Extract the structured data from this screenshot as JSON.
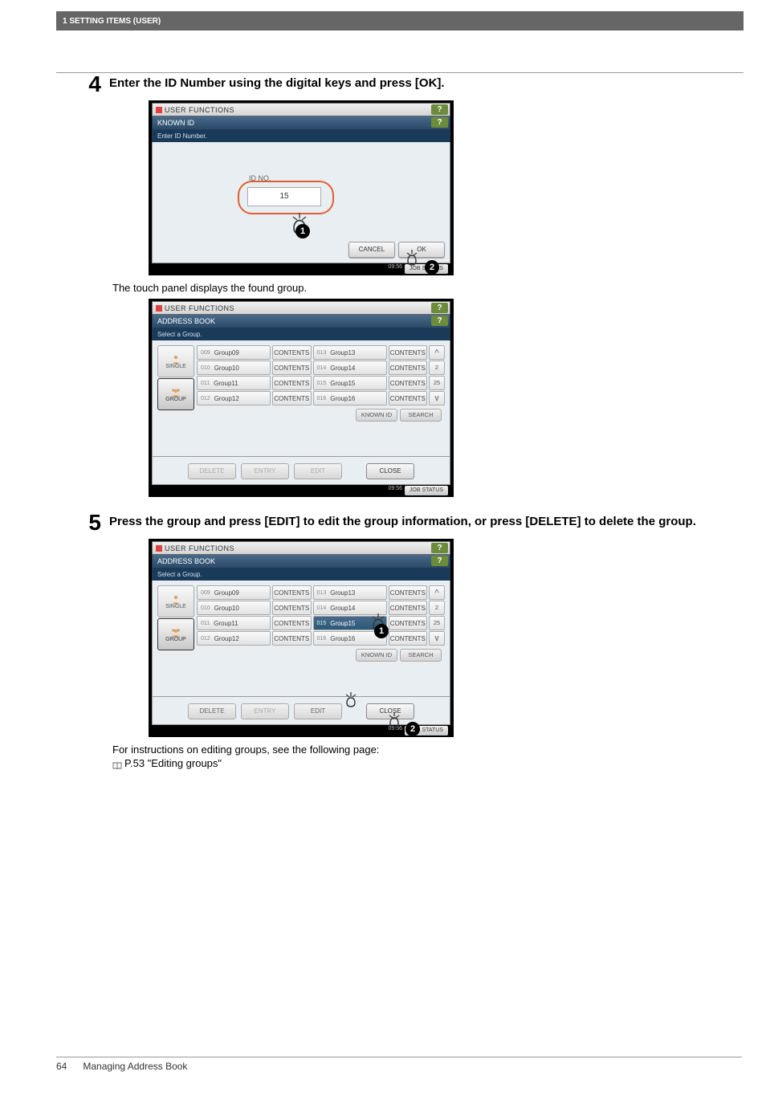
{
  "header": {
    "title": "1 SETTING ITEMS (USER)"
  },
  "step4": {
    "num": "4",
    "text": "Enter the ID Number using the digital keys and press [OK].",
    "after": "The touch panel displays the found group."
  },
  "step5": {
    "num": "5",
    "text": "Press the group and press [EDIT] to edit the group information, or press [DELETE] to delete the group.",
    "after1": "For instructions on editing groups, see the following page:",
    "after2": "P.53 \"Editing groups\""
  },
  "panel1": {
    "title": "USER FUNCTIONS",
    "subtitle": "KNOWN ID",
    "note": "Enter ID Number.",
    "idno_label": "ID NO.",
    "id_value": "15",
    "cancel": "CANCEL",
    "ok": "OK",
    "time": "09:56",
    "status": "JOB STATUS",
    "help": "?",
    "badge1": "1",
    "badge2": "2"
  },
  "panelA": {
    "title": "USER FUNCTIONS",
    "subtitle": "ADDRESS BOOK",
    "note": "Select a Group.",
    "tab_single": "SINGLE",
    "tab_group": "GROUP",
    "contents": "CONTENTS",
    "known_id": "KNOWN ID",
    "search": "SEARCH",
    "delete": "DELETE",
    "entry": "ENTRY",
    "edit": "EDIT",
    "close": "CLOSE",
    "page_cur": "2",
    "page_total": "25",
    "time": "09:56",
    "status": "JOB STATUS",
    "help": "?",
    "rows_left": [
      {
        "num": "009",
        "name": "Group09"
      },
      {
        "num": "010",
        "name": "Group10"
      },
      {
        "num": "011",
        "name": "Group11"
      },
      {
        "num": "012",
        "name": "Group12"
      }
    ],
    "rows_right": [
      {
        "num": "013",
        "name": "Group13"
      },
      {
        "num": "014",
        "name": "Group14"
      },
      {
        "num": "015",
        "name": "Group15"
      },
      {
        "num": "016",
        "name": "Group16"
      }
    ]
  },
  "panelB": {
    "badge1": "1",
    "badge2": "2"
  },
  "footer": {
    "page_num": "64",
    "section": "Managing Address Book"
  }
}
